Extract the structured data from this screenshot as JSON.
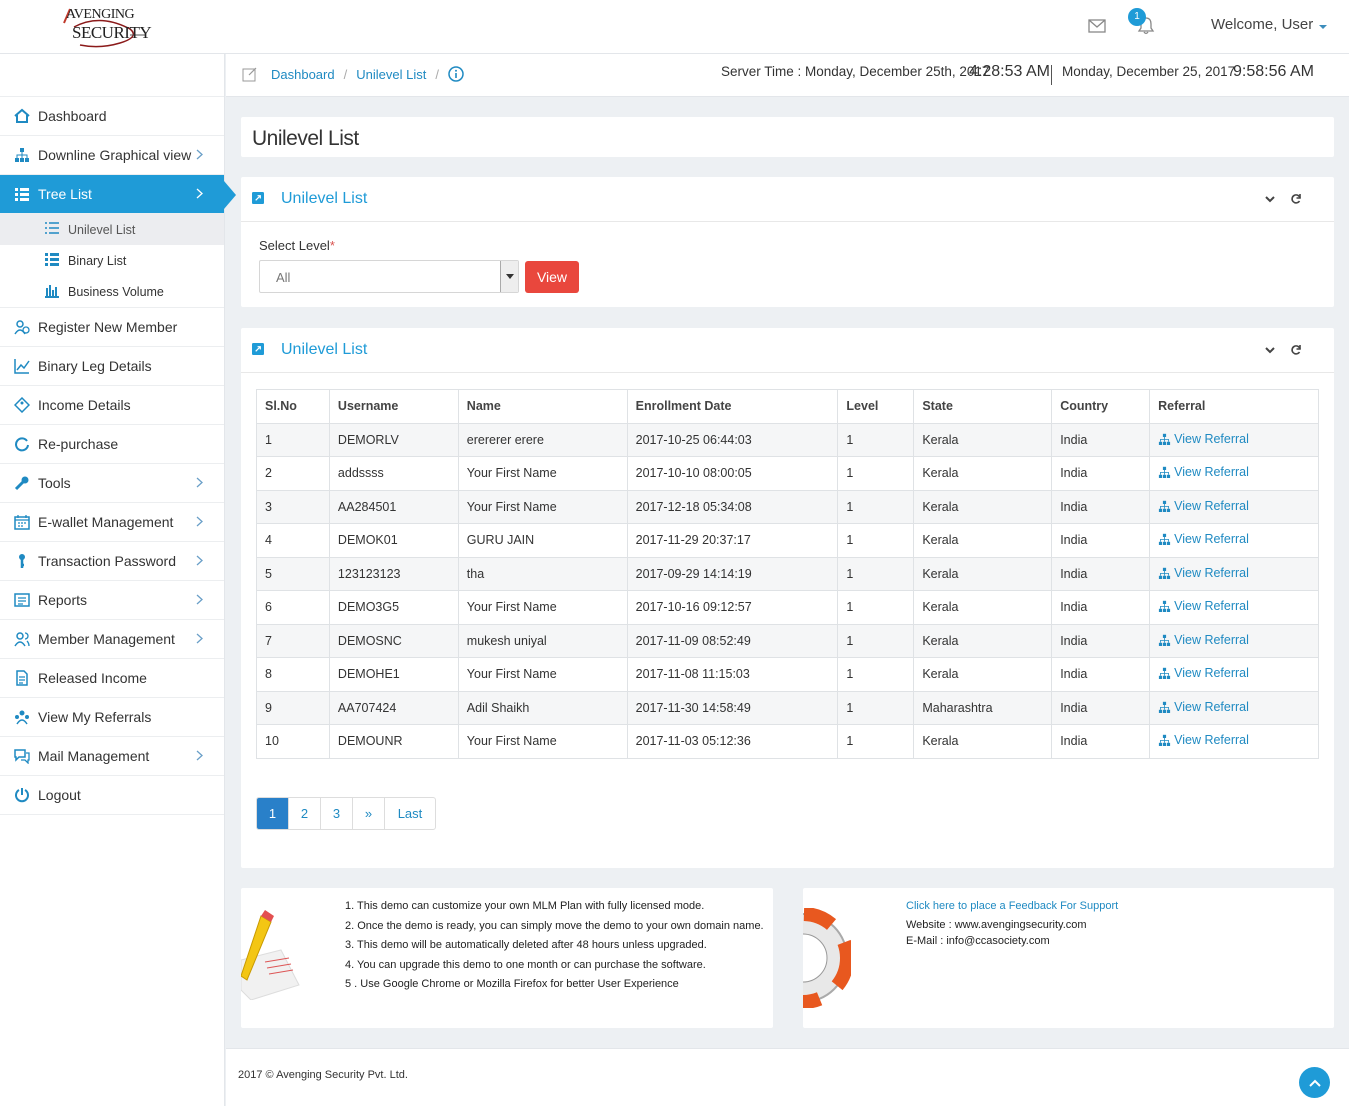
{
  "brand": {
    "line1": "AVENGING",
    "line2": "SECURITY"
  },
  "header": {
    "notification_count": "1",
    "welcome": "Welcome, User"
  },
  "sidebar": {
    "items": [
      {
        "label": "Dashboard",
        "icon": "home-icon",
        "chevron": false
      },
      {
        "label": "Downline Graphical view",
        "icon": "sitemap-icon",
        "chevron": true
      },
      {
        "label": "Tree List",
        "icon": "list-icon",
        "chevron": true,
        "active": true
      },
      {
        "label": "Register New Member",
        "icon": "register-icon",
        "chevron": false
      },
      {
        "label": "Binary Leg Details",
        "icon": "line-chart-icon",
        "chevron": false
      },
      {
        "label": "Income Details",
        "icon": "tag-icon",
        "chevron": false
      },
      {
        "label": "Re-purchase",
        "icon": "refresh-circle-icon",
        "chevron": false
      },
      {
        "label": "Tools",
        "icon": "wrench-icon",
        "chevron": true
      },
      {
        "label": "E-wallet Management",
        "icon": "calendar-icon",
        "chevron": true
      },
      {
        "label": "Transaction Password",
        "icon": "key-icon",
        "chevron": true
      },
      {
        "label": "Reports",
        "icon": "reports-icon",
        "chevron": true
      },
      {
        "label": "Member Management",
        "icon": "users-icon",
        "chevron": true
      },
      {
        "label": "Released Income",
        "icon": "document-icon",
        "chevron": false
      },
      {
        "label": "View My Referrals",
        "icon": "referrals-icon",
        "chevron": false
      },
      {
        "label": "Mail Management",
        "icon": "chat-icon",
        "chevron": true
      },
      {
        "label": "Logout",
        "icon": "power-icon",
        "chevron": false
      }
    ],
    "subitems": [
      {
        "label": "Unilevel List",
        "icon": "list-numbered-icon",
        "active": true
      },
      {
        "label": "Binary List",
        "icon": "list-icon"
      },
      {
        "label": "Business Volume",
        "icon": "bar-chart-icon"
      }
    ]
  },
  "breadcrumb": {
    "home": "Dashboard",
    "current": "Unilevel List"
  },
  "server_time": {
    "label": "Server Time : Monday, December 25th, 2017",
    "time": "4:28:53 AM",
    "local_date": "Monday, December 25, 2017",
    "local_time": "9:58:56 AM"
  },
  "page_title": "Unilevel List",
  "filter_panel": {
    "title": "Unilevel List",
    "label": "Select Level",
    "required_mark": "*",
    "selected": "All",
    "button": "View"
  },
  "list_panel": {
    "title": "Unilevel List",
    "columns": [
      "Sl.No",
      "Username",
      "Name",
      "Enrollment Date",
      "Level",
      "State",
      "Country",
      "Referral"
    ],
    "rows": [
      [
        "1",
        "DEMORLV",
        "erererer erere",
        "2017-10-25 06:44:03",
        "1",
        "Kerala",
        "India",
        "View Referral"
      ],
      [
        "2",
        "addssss",
        "Your First Name",
        "2017-10-10 08:00:05",
        "1",
        "Kerala",
        "India",
        "View Referral"
      ],
      [
        "3",
        "AA284501",
        "Your First Name",
        "2017-12-18 05:34:08",
        "1",
        "Kerala",
        "India",
        "View Referral"
      ],
      [
        "4",
        "DEMOK01",
        "GURU JAIN",
        "2017-11-29 20:37:17",
        "1",
        "Kerala",
        "India",
        "View Referral"
      ],
      [
        "5",
        "123123123",
        "tha",
        "2017-09-29 14:14:19",
        "1",
        "Kerala",
        "India",
        "View Referral"
      ],
      [
        "6",
        "DEMO3G5",
        "Your First Name",
        "2017-10-16 09:12:57",
        "1",
        "Kerala",
        "India",
        "View Referral"
      ],
      [
        "7",
        "DEMOSNC",
        "mukesh uniyal",
        "2017-11-09 08:52:49",
        "1",
        "Kerala",
        "India",
        "View Referral"
      ],
      [
        "8",
        "DEMOHE1",
        "Your First Name",
        "2017-11-08 11:15:03",
        "1",
        "Kerala",
        "India",
        "View Referral"
      ],
      [
        "9",
        "AA707424",
        "Adil Shaikh",
        "2017-11-30 14:58:49",
        "1",
        "Maharashtra",
        "India",
        "View Referral"
      ],
      [
        "10",
        "DEMOUNR",
        "Your First Name",
        "2017-11-03 05:12:36",
        "1",
        "Kerala",
        "India",
        "View Referral"
      ]
    ],
    "pagination": [
      "1",
      "2",
      "3",
      "»",
      "Last"
    ]
  },
  "notes": [
    "1. This demo can customize your own MLM Plan with fully licensed mode.",
    "2. Once the demo is ready, you can simply move the demo to your own domain name.",
    "3. This demo will be automatically deleted after 48 hours unless upgraded.",
    "4. You can upgrade this demo to one month or can purchase the software.",
    "5 . Use Google Chrome or Mozilla Firefox for better User Experience"
  ],
  "support": {
    "link": "Click here to place a Feedback For Support",
    "website": "Website : www.avengingsecurity.com",
    "email": "E-Mail : info@ccasociety.com"
  },
  "footer": {
    "copyright": "2017 © Avenging Security Pvt. Ltd."
  },
  "colors": {
    "accent": "#1f9bd7",
    "danger": "#e9473d",
    "link": "#1f8ac2"
  }
}
